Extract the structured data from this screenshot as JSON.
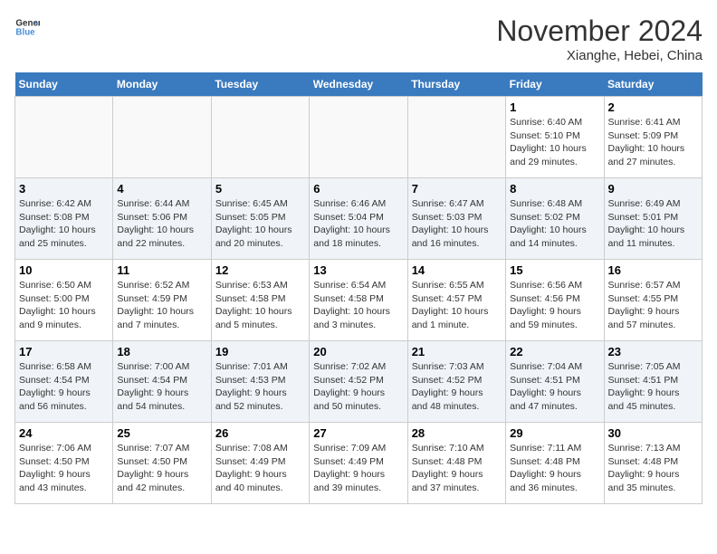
{
  "header": {
    "logo_line1": "General",
    "logo_line2": "Blue",
    "month": "November 2024",
    "location": "Xianghe, Hebei, China"
  },
  "weekdays": [
    "Sunday",
    "Monday",
    "Tuesday",
    "Wednesday",
    "Thursday",
    "Friday",
    "Saturday"
  ],
  "weeks": [
    [
      {
        "day": "",
        "info": ""
      },
      {
        "day": "",
        "info": ""
      },
      {
        "day": "",
        "info": ""
      },
      {
        "day": "",
        "info": ""
      },
      {
        "day": "",
        "info": ""
      },
      {
        "day": "1",
        "info": "Sunrise: 6:40 AM\nSunset: 5:10 PM\nDaylight: 10 hours\nand 29 minutes."
      },
      {
        "day": "2",
        "info": "Sunrise: 6:41 AM\nSunset: 5:09 PM\nDaylight: 10 hours\nand 27 minutes."
      }
    ],
    [
      {
        "day": "3",
        "info": "Sunrise: 6:42 AM\nSunset: 5:08 PM\nDaylight: 10 hours\nand 25 minutes."
      },
      {
        "day": "4",
        "info": "Sunrise: 6:44 AM\nSunset: 5:06 PM\nDaylight: 10 hours\nand 22 minutes."
      },
      {
        "day": "5",
        "info": "Sunrise: 6:45 AM\nSunset: 5:05 PM\nDaylight: 10 hours\nand 20 minutes."
      },
      {
        "day": "6",
        "info": "Sunrise: 6:46 AM\nSunset: 5:04 PM\nDaylight: 10 hours\nand 18 minutes."
      },
      {
        "day": "7",
        "info": "Sunrise: 6:47 AM\nSunset: 5:03 PM\nDaylight: 10 hours\nand 16 minutes."
      },
      {
        "day": "8",
        "info": "Sunrise: 6:48 AM\nSunset: 5:02 PM\nDaylight: 10 hours\nand 14 minutes."
      },
      {
        "day": "9",
        "info": "Sunrise: 6:49 AM\nSunset: 5:01 PM\nDaylight: 10 hours\nand 11 minutes."
      }
    ],
    [
      {
        "day": "10",
        "info": "Sunrise: 6:50 AM\nSunset: 5:00 PM\nDaylight: 10 hours\nand 9 minutes."
      },
      {
        "day": "11",
        "info": "Sunrise: 6:52 AM\nSunset: 4:59 PM\nDaylight: 10 hours\nand 7 minutes."
      },
      {
        "day": "12",
        "info": "Sunrise: 6:53 AM\nSunset: 4:58 PM\nDaylight: 10 hours\nand 5 minutes."
      },
      {
        "day": "13",
        "info": "Sunrise: 6:54 AM\nSunset: 4:58 PM\nDaylight: 10 hours\nand 3 minutes."
      },
      {
        "day": "14",
        "info": "Sunrise: 6:55 AM\nSunset: 4:57 PM\nDaylight: 10 hours\nand 1 minute."
      },
      {
        "day": "15",
        "info": "Sunrise: 6:56 AM\nSunset: 4:56 PM\nDaylight: 9 hours\nand 59 minutes."
      },
      {
        "day": "16",
        "info": "Sunrise: 6:57 AM\nSunset: 4:55 PM\nDaylight: 9 hours\nand 57 minutes."
      }
    ],
    [
      {
        "day": "17",
        "info": "Sunrise: 6:58 AM\nSunset: 4:54 PM\nDaylight: 9 hours\nand 56 minutes."
      },
      {
        "day": "18",
        "info": "Sunrise: 7:00 AM\nSunset: 4:54 PM\nDaylight: 9 hours\nand 54 minutes."
      },
      {
        "day": "19",
        "info": "Sunrise: 7:01 AM\nSunset: 4:53 PM\nDaylight: 9 hours\nand 52 minutes."
      },
      {
        "day": "20",
        "info": "Sunrise: 7:02 AM\nSunset: 4:52 PM\nDaylight: 9 hours\nand 50 minutes."
      },
      {
        "day": "21",
        "info": "Sunrise: 7:03 AM\nSunset: 4:52 PM\nDaylight: 9 hours\nand 48 minutes."
      },
      {
        "day": "22",
        "info": "Sunrise: 7:04 AM\nSunset: 4:51 PM\nDaylight: 9 hours\nand 47 minutes."
      },
      {
        "day": "23",
        "info": "Sunrise: 7:05 AM\nSunset: 4:51 PM\nDaylight: 9 hours\nand 45 minutes."
      }
    ],
    [
      {
        "day": "24",
        "info": "Sunrise: 7:06 AM\nSunset: 4:50 PM\nDaylight: 9 hours\nand 43 minutes."
      },
      {
        "day": "25",
        "info": "Sunrise: 7:07 AM\nSunset: 4:50 PM\nDaylight: 9 hours\nand 42 minutes."
      },
      {
        "day": "26",
        "info": "Sunrise: 7:08 AM\nSunset: 4:49 PM\nDaylight: 9 hours\nand 40 minutes."
      },
      {
        "day": "27",
        "info": "Sunrise: 7:09 AM\nSunset: 4:49 PM\nDaylight: 9 hours\nand 39 minutes."
      },
      {
        "day": "28",
        "info": "Sunrise: 7:10 AM\nSunset: 4:48 PM\nDaylight: 9 hours\nand 37 minutes."
      },
      {
        "day": "29",
        "info": "Sunrise: 7:11 AM\nSunset: 4:48 PM\nDaylight: 9 hours\nand 36 minutes."
      },
      {
        "day": "30",
        "info": "Sunrise: 7:13 AM\nSunset: 4:48 PM\nDaylight: 9 hours\nand 35 minutes."
      }
    ]
  ]
}
